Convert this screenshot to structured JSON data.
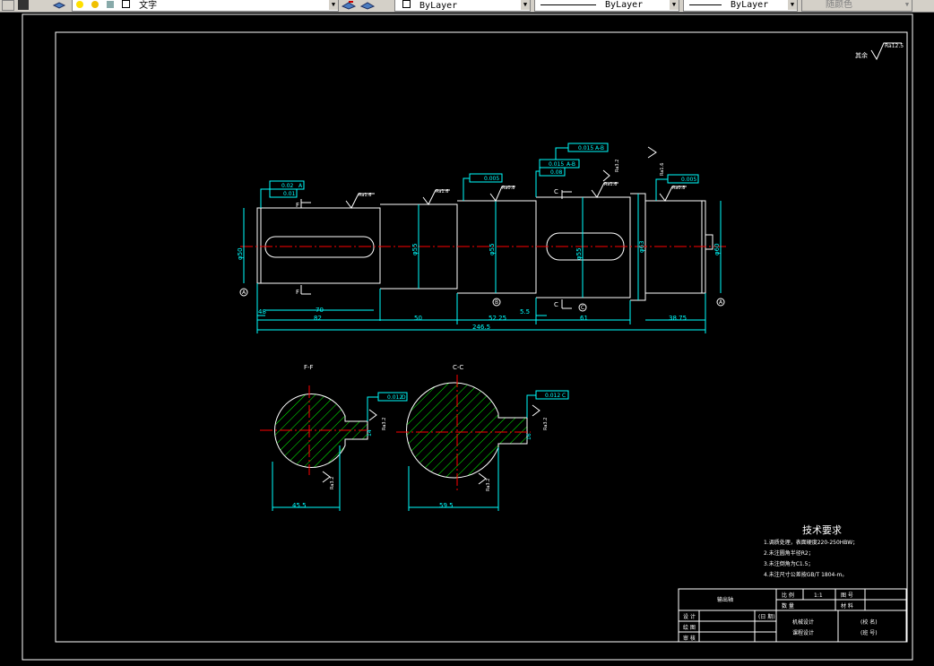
{
  "toolbar": {
    "layer_name": "文字",
    "color_combo": "ByLayer",
    "linetype_combo": "ByLayer",
    "lineweight_combo": "ByLayer",
    "plotstyle_combo": "随颜色"
  },
  "drawing": {
    "roughness_general_prefix": "其余",
    "roughness_general": "Ra12.5",
    "dims": {
      "d48": "48",
      "d82": "82",
      "d70": "70",
      "d50": "50",
      "d5225": "52.25",
      "d55": "5.5",
      "d61": "61",
      "d3875": "38.75",
      "d2465": "246.5",
      "phi50": "φ50",
      "phi55a": "φ55",
      "phi55b": "φ55",
      "phi55c": "φ55",
      "phi63": "φ63",
      "phi60": "φ60"
    },
    "gtol": {
      "g1": "0.02",
      "g1ref": "A",
      "g2": "0.01",
      "g3": "0.005",
      "g4": "0.015",
      "g4ref": "A-B",
      "g5": "0.08",
      "g6": "0.015",
      "g6ref": "A-B",
      "g7": "0.005",
      "gF": "0.012",
      "gFref": "D",
      "gC": "0.012",
      "gCref": "C"
    },
    "rough": {
      "r16": "Ra1.6",
      "r08": "Ra0.8",
      "r32": "Ra3.2"
    },
    "datums": {
      "a": "A",
      "b": "B",
      "c": "C",
      "d": "D"
    },
    "section_labels": {
      "f": "F",
      "c": "C",
      "ff": "F-F",
      "cc": "C-C"
    },
    "section_dims": {
      "f_width": "45.5",
      "c_width": "59.5",
      "f_key": "14",
      "c_key": "16"
    },
    "tech_req": {
      "title": "技术要求",
      "lines": [
        "1.调质处理，表面硬度220-250HBW；",
        "2.未注圆角半径R2；",
        "3.未注倒角为C1.5；",
        "4.未注尺寸公差按GB/T 1804-m。"
      ]
    },
    "title_block": {
      "part_name": "输出轴",
      "scale_label": "比 例",
      "scale_value": "1:1",
      "drawing_no_label": "图 号",
      "quantity_label": "数 量",
      "material_label": "材 料",
      "designer_label": "设 计",
      "date_label": "(日 期)",
      "drawer_label": "绘 图",
      "reviewer_label": "审 核",
      "course_1": "机械设计",
      "course_2": "课程设计",
      "school": "(校 名)",
      "class": "(班 号)"
    }
  }
}
